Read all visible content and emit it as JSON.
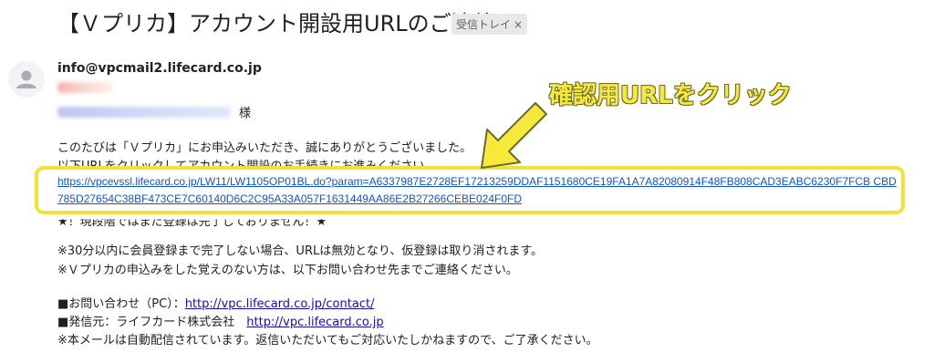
{
  "email": {
    "subject": "【Ｖプリカ】アカウント開設用URLのご連絡",
    "label_badge": "受信トレイ",
    "label_close": "×",
    "sender": "info@vpcmail2.lifecard.co.jp",
    "honorific": "様",
    "greeting": "このたびは「Ｖプリカ」にお申込みいただき、誠にありがとうございました。",
    "instruction_partial": "以下URLをクリックしてアカウント開設のお手続きにお進みください。",
    "link_line1": "https://vpcevssl.lifecard.co.jp/LW11/LW1105OP01BL.do?param=A6337987E2728EF17213259DDAF1151680CE19FA1A7A82080914F48FB808CAD3EABC6230F7FCB CBD",
    "link_line2": "785D27654C38BF473CE7C60140D6C2C95A33A057F1631449AA86E2B27266CEBE024F0FD",
    "note_partial": "★！現段階ではまだ登録は完了しておりません！★",
    "notice1": "※30分以内に会員登録まで完了しない場合、URLは無効となり、仮登録は取り消されます。",
    "notice2": "※Ｖプリカの申込みをした覚えのない方は、以下お問い合わせ先までご連絡ください。",
    "contact_label": "■お問い合わせ（PC）：",
    "contact_url": "http://vpc.lifecard.co.jp/contact/",
    "from_label": "■発信元：ライフカード株式会社　",
    "from_url": "http://vpc.lifecard.co.jp",
    "auto_notice": "※本メールは自動配信されています。返信いただいてもご対応いたしかねますので、ご了承ください。"
  },
  "annotation": {
    "callout_text": "確認用URLをクリック",
    "highlight_color": "#efe33b"
  },
  "colors": {
    "link": "#1155cc",
    "text": "#202124",
    "badge_bg": "#e8e8e8"
  }
}
